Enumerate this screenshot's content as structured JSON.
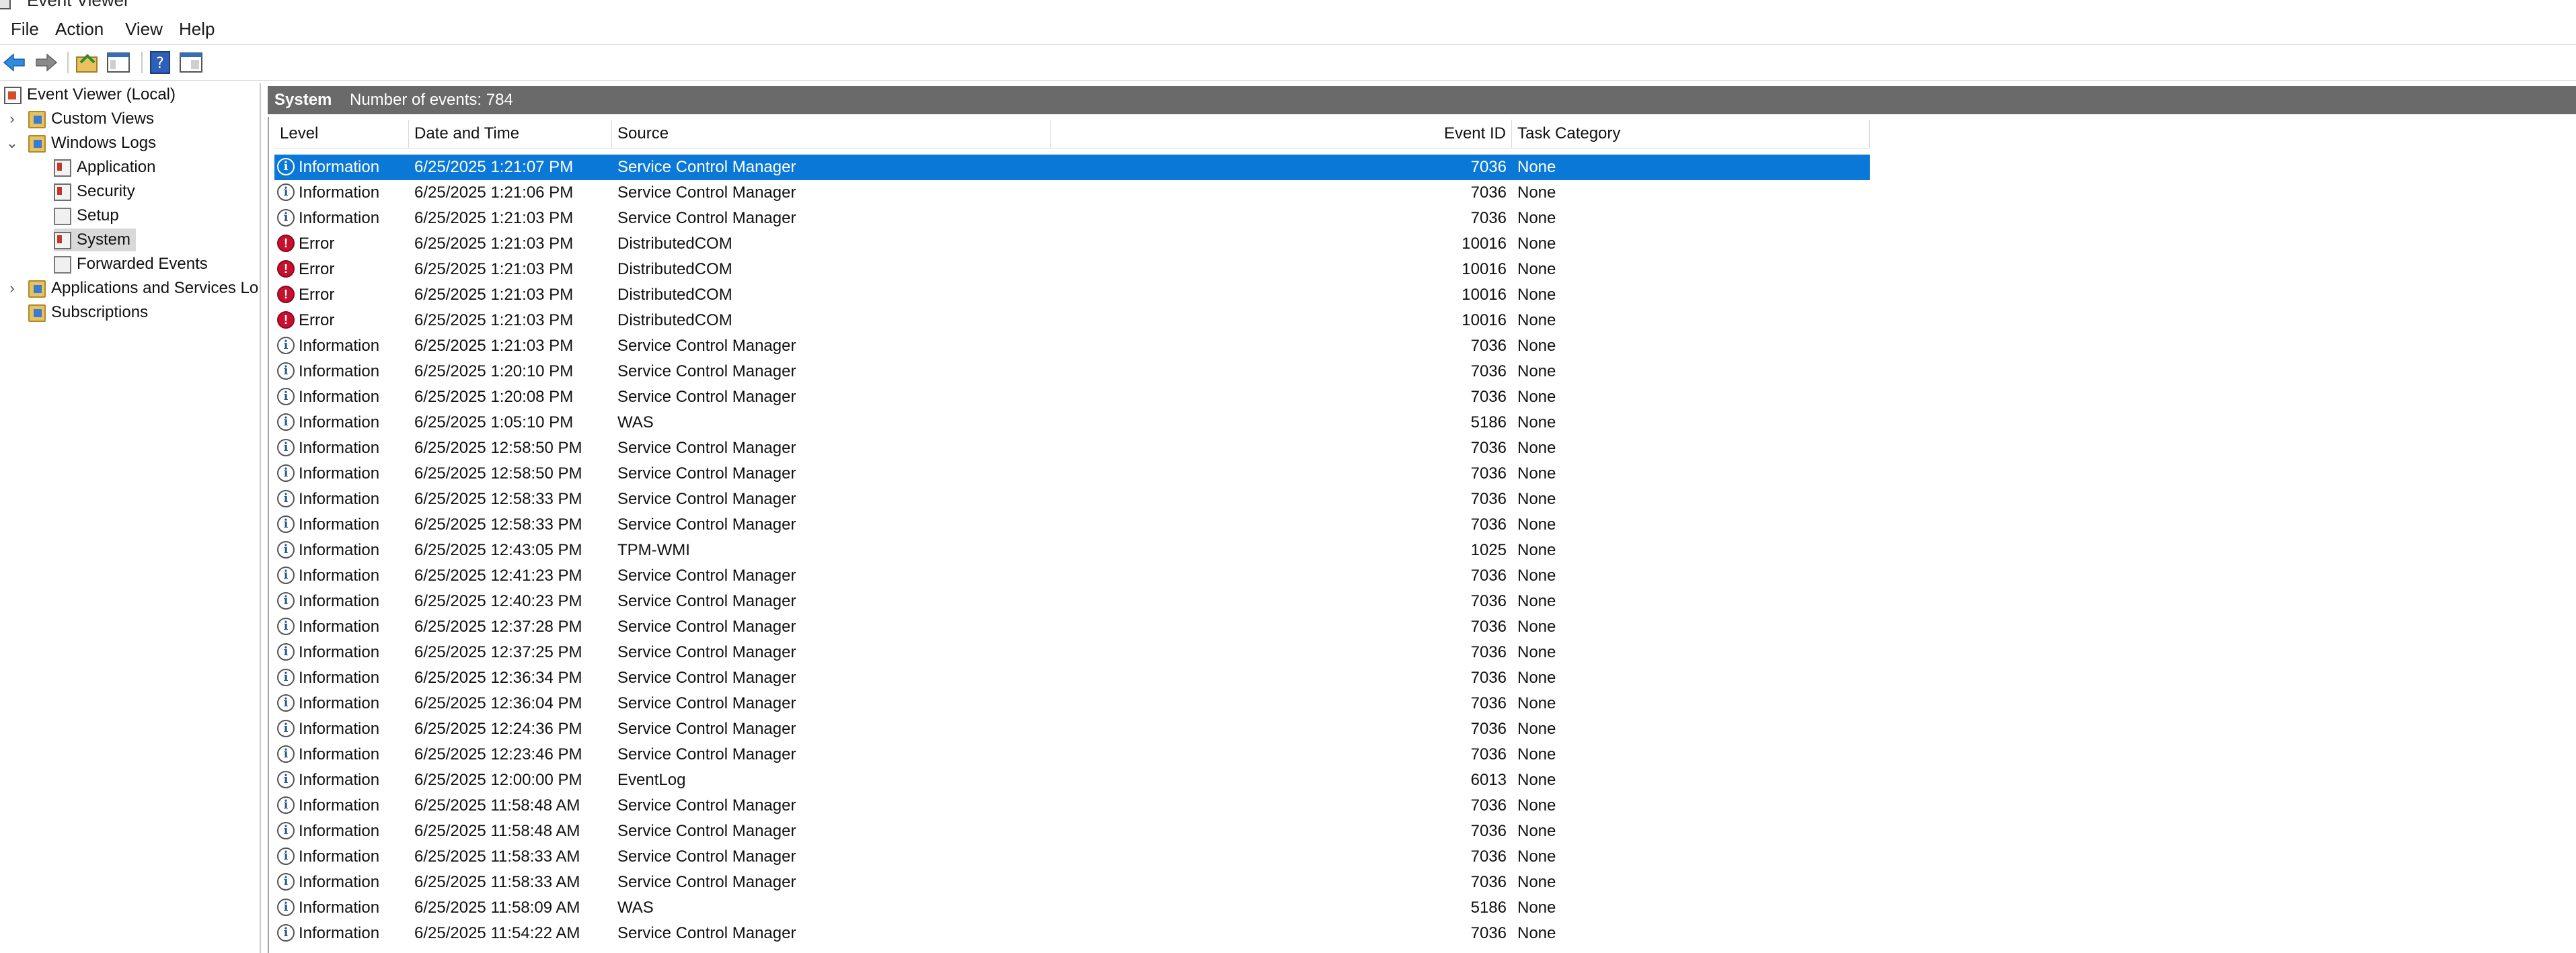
{
  "window": {
    "title": "Event Viewer"
  },
  "menu": [
    "File",
    "Action",
    "View",
    "Help"
  ],
  "toolbar": {
    "icons": [
      "back-arrow-icon",
      "forward-arrow-icon",
      "open-folder-icon",
      "show-hide-tree-icon",
      "help-icon",
      "properties-icon"
    ]
  },
  "tree": {
    "root": "Event Viewer (Local)",
    "custom_views": "Custom Views",
    "windows_logs": "Windows Logs",
    "logs": [
      "Application",
      "Security",
      "Setup",
      "System",
      "Forwarded Events"
    ],
    "selected": "System",
    "apps_services": "Applications and Services Lo",
    "subscriptions": "Subscriptions"
  },
  "header": {
    "title": "System",
    "count_text": "Number of events: 784"
  },
  "columns": {
    "level": "Level",
    "datetime": "Date and Time",
    "source": "Source",
    "event_id": "Event ID",
    "task_category": "Task Category"
  },
  "events": [
    {
      "level": "Information",
      "datetime": "6/25/2025 1:21:07 PM",
      "source": "Service Control Manager",
      "event_id": "7036",
      "task": "None",
      "selected": true
    },
    {
      "level": "Information",
      "datetime": "6/25/2025 1:21:06 PM",
      "source": "Service Control Manager",
      "event_id": "7036",
      "task": "None"
    },
    {
      "level": "Information",
      "datetime": "6/25/2025 1:21:03 PM",
      "source": "Service Control Manager",
      "event_id": "7036",
      "task": "None"
    },
    {
      "level": "Error",
      "datetime": "6/25/2025 1:21:03 PM",
      "source": "DistributedCOM",
      "event_id": "10016",
      "task": "None"
    },
    {
      "level": "Error",
      "datetime": "6/25/2025 1:21:03 PM",
      "source": "DistributedCOM",
      "event_id": "10016",
      "task": "None"
    },
    {
      "level": "Error",
      "datetime": "6/25/2025 1:21:03 PM",
      "source": "DistributedCOM",
      "event_id": "10016",
      "task": "None"
    },
    {
      "level": "Error",
      "datetime": "6/25/2025 1:21:03 PM",
      "source": "DistributedCOM",
      "event_id": "10016",
      "task": "None"
    },
    {
      "level": "Information",
      "datetime": "6/25/2025 1:21:03 PM",
      "source": "Service Control Manager",
      "event_id": "7036",
      "task": "None"
    },
    {
      "level": "Information",
      "datetime": "6/25/2025 1:20:10 PM",
      "source": "Service Control Manager",
      "event_id": "7036",
      "task": "None"
    },
    {
      "level": "Information",
      "datetime": "6/25/2025 1:20:08 PM",
      "source": "Service Control Manager",
      "event_id": "7036",
      "task": "None"
    },
    {
      "level": "Information",
      "datetime": "6/25/2025 1:05:10 PM",
      "source": "WAS",
      "event_id": "5186",
      "task": "None"
    },
    {
      "level": "Information",
      "datetime": "6/25/2025 12:58:50 PM",
      "source": "Service Control Manager",
      "event_id": "7036",
      "task": "None"
    },
    {
      "level": "Information",
      "datetime": "6/25/2025 12:58:50 PM",
      "source": "Service Control Manager",
      "event_id": "7036",
      "task": "None"
    },
    {
      "level": "Information",
      "datetime": "6/25/2025 12:58:33 PM",
      "source": "Service Control Manager",
      "event_id": "7036",
      "task": "None"
    },
    {
      "level": "Information",
      "datetime": "6/25/2025 12:58:33 PM",
      "source": "Service Control Manager",
      "event_id": "7036",
      "task": "None"
    },
    {
      "level": "Information",
      "datetime": "6/25/2025 12:43:05 PM",
      "source": "TPM-WMI",
      "event_id": "1025",
      "task": "None"
    },
    {
      "level": "Information",
      "datetime": "6/25/2025 12:41:23 PM",
      "source": "Service Control Manager",
      "event_id": "7036",
      "task": "None"
    },
    {
      "level": "Information",
      "datetime": "6/25/2025 12:40:23 PM",
      "source": "Service Control Manager",
      "event_id": "7036",
      "task": "None"
    },
    {
      "level": "Information",
      "datetime": "6/25/2025 12:37:28 PM",
      "source": "Service Control Manager",
      "event_id": "7036",
      "task": "None"
    },
    {
      "level": "Information",
      "datetime": "6/25/2025 12:37:25 PM",
      "source": "Service Control Manager",
      "event_id": "7036",
      "task": "None"
    },
    {
      "level": "Information",
      "datetime": "6/25/2025 12:36:34 PM",
      "source": "Service Control Manager",
      "event_id": "7036",
      "task": "None"
    },
    {
      "level": "Information",
      "datetime": "6/25/2025 12:36:04 PM",
      "source": "Service Control Manager",
      "event_id": "7036",
      "task": "None"
    },
    {
      "level": "Information",
      "datetime": "6/25/2025 12:24:36 PM",
      "source": "Service Control Manager",
      "event_id": "7036",
      "task": "None"
    },
    {
      "level": "Information",
      "datetime": "6/25/2025 12:23:46 PM",
      "source": "Service Control Manager",
      "event_id": "7036",
      "task": "None"
    },
    {
      "level": "Information",
      "datetime": "6/25/2025 12:00:00 PM",
      "source": "EventLog",
      "event_id": "6013",
      "task": "None"
    },
    {
      "level": "Information",
      "datetime": "6/25/2025 11:58:48 AM",
      "source": "Service Control Manager",
      "event_id": "7036",
      "task": "None"
    },
    {
      "level": "Information",
      "datetime": "6/25/2025 11:58:48 AM",
      "source": "Service Control Manager",
      "event_id": "7036",
      "task": "None"
    },
    {
      "level": "Information",
      "datetime": "6/25/2025 11:58:33 AM",
      "source": "Service Control Manager",
      "event_id": "7036",
      "task": "None"
    },
    {
      "level": "Information",
      "datetime": "6/25/2025 11:58:33 AM",
      "source": "Service Control Manager",
      "event_id": "7036",
      "task": "None"
    },
    {
      "level": "Information",
      "datetime": "6/25/2025 11:58:09 AM",
      "source": "WAS",
      "event_id": "5186",
      "task": "None"
    },
    {
      "level": "Information",
      "datetime": "6/25/2025 11:54:22 AM",
      "source": "Service Control Manager",
      "event_id": "7036",
      "task": "None"
    }
  ]
}
